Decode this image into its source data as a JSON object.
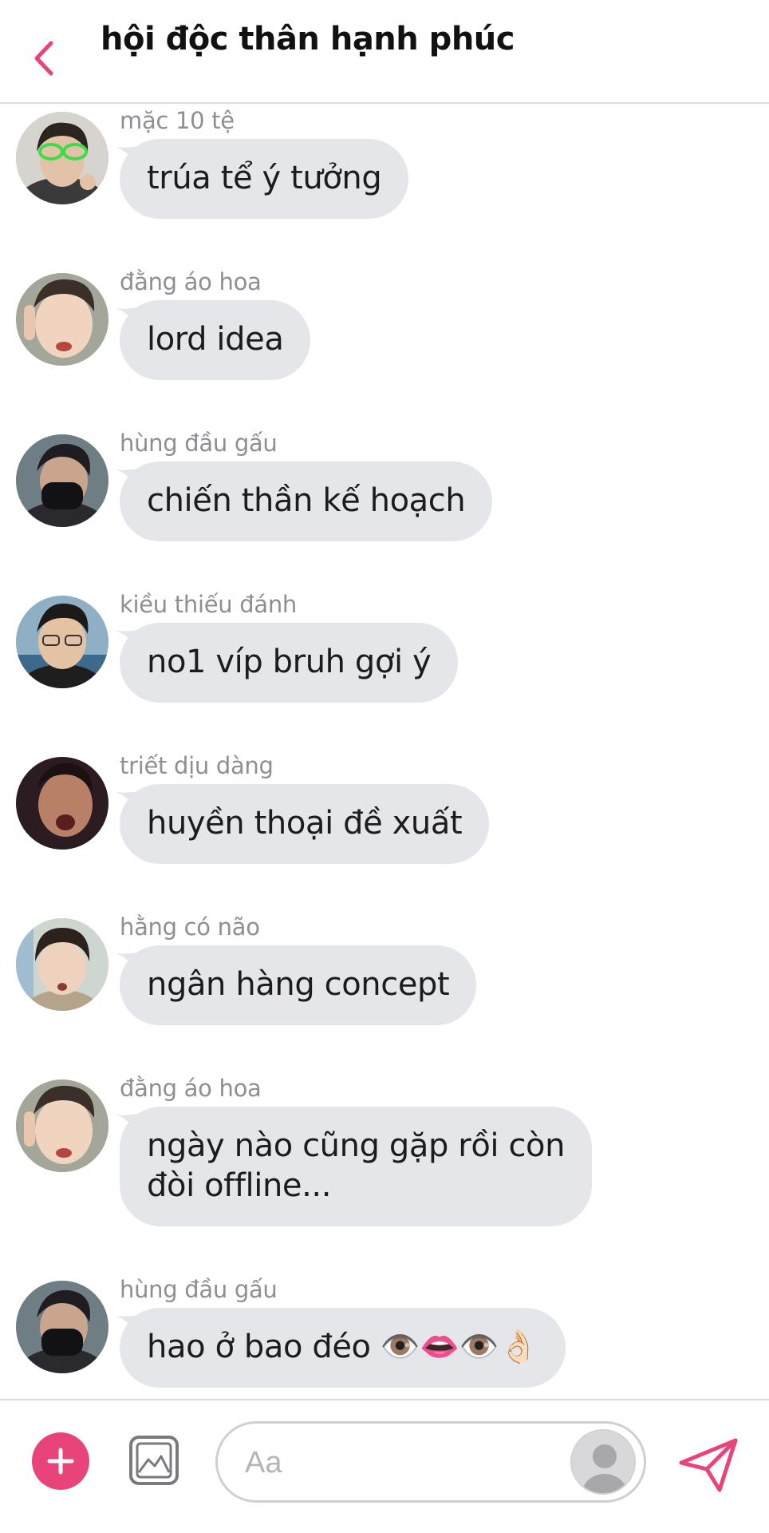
{
  "header": {
    "title": "hội độc thân hạnh phúc",
    "back_icon": "chevron-left-icon",
    "accent_color": "#e8447a"
  },
  "messages": [
    {
      "sender": "mặc 10 tệ",
      "text": "trúa tể ý tưởng"
    },
    {
      "sender": "đằng áo hoa",
      "text": "lord idea"
    },
    {
      "sender": "hùng đầu gấu",
      "text": "chiến thần kế hoạch"
    },
    {
      "sender": "kiều thiếu đánh",
      "text": "no1 víp bruh gợi ý"
    },
    {
      "sender": "triết dịu dàng",
      "text": "huyền thoại đề xuất"
    },
    {
      "sender": "hằng có não",
      "text": "ngân hàng concept"
    },
    {
      "sender": "đằng áo hoa",
      "text": "ngày nào cũng gặp rồi còn\nđòi offline..."
    },
    {
      "sender": "hùng đầu gấu",
      "text": "hao ở bao đéo 👁️👄👁️👌🏻"
    }
  ],
  "composer": {
    "placeholder": "Aa",
    "plus_icon": "plus-icon",
    "image_icon": "image-icon",
    "send_icon": "send-icon"
  },
  "colors": {
    "bubble": "#e5e6ea",
    "sender_text": "#8e8e93",
    "accent": "#e8447a"
  }
}
